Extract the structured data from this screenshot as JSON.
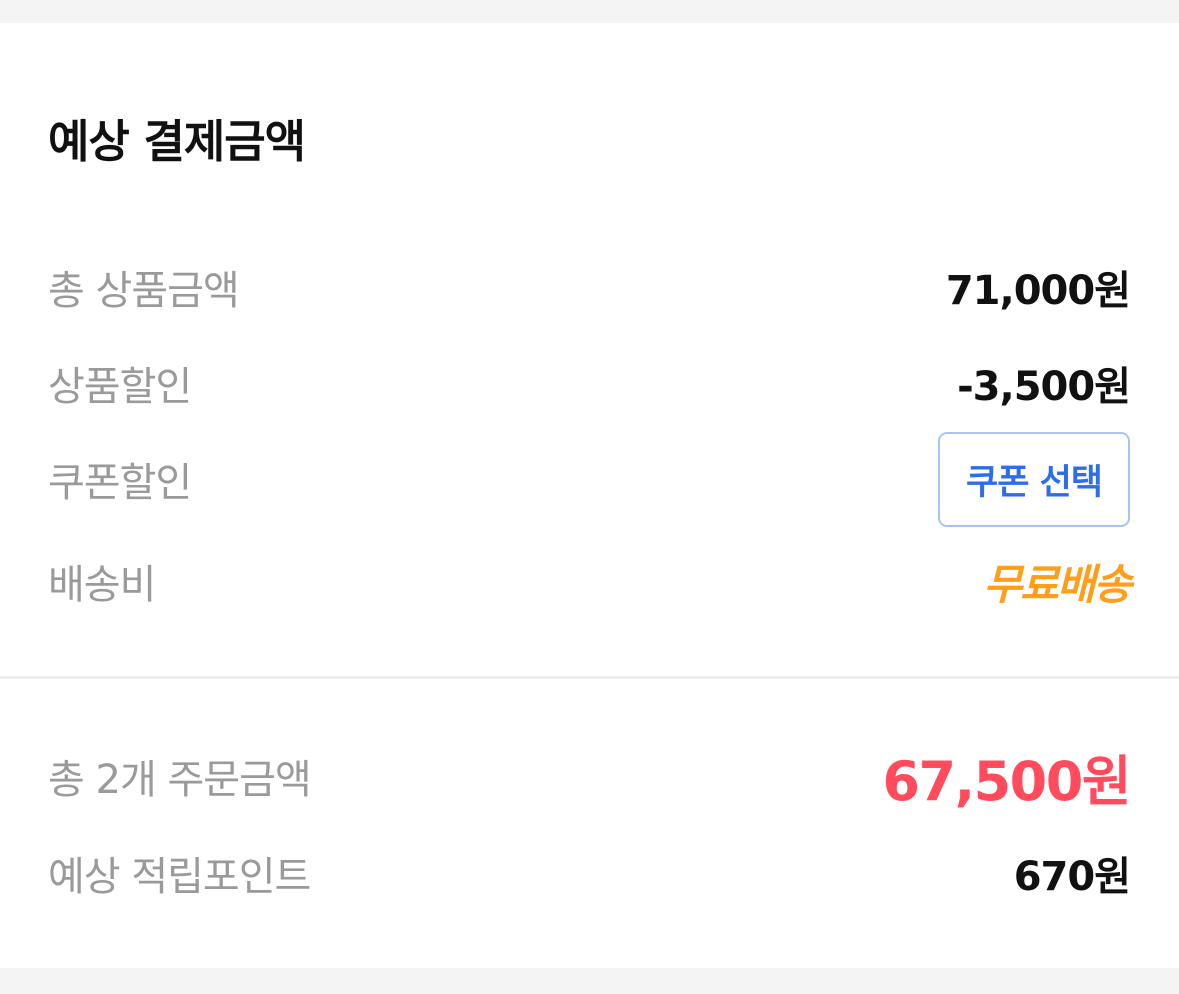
{
  "section_title": "예상 결제금액",
  "price_rows": [
    {
      "label": "총 상품금액",
      "value": "71,000원"
    },
    {
      "label": "상품할인",
      "value": "-3,500원"
    },
    {
      "label": "쿠폰할인",
      "button_label": "쿠폰 선택"
    },
    {
      "label": "배송비",
      "value": "무료배송"
    }
  ],
  "summary_rows": [
    {
      "label": "총 2개 주문금액",
      "value": "67,500원"
    },
    {
      "label": "예상 적립포인트",
      "value": "670원"
    }
  ],
  "colors": {
    "background": "#f4f4f4",
    "card": "#ffffff",
    "label": "#9a9a9a",
    "value": "#111111",
    "total_accent": "#ff4b5c",
    "free_shipping": "#ff9e1b",
    "coupon_button_text": "#2e6de6",
    "coupon_button_border": "#a9c3f6"
  }
}
